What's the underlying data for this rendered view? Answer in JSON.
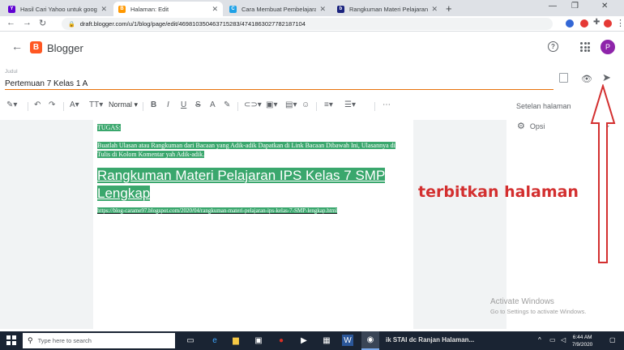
{
  "browser": {
    "tabs": [
      {
        "label": "Hasil Cari Yahoo untuk google",
        "fav_color": "#6001d2",
        "fav_text": "Y"
      },
      {
        "label": "Halaman: Edit",
        "fav_color": "#ff9800",
        "fav_text": "B"
      },
      {
        "label": "Cara Membuat Pembelajaran On",
        "fav_color": "#1ea1e6",
        "fav_text": "C"
      },
      {
        "label": "Rangkuman Materi Pelajaran IPS",
        "fav_color": "#1a237e",
        "fav_text": "bl"
      }
    ],
    "new_tab": "+",
    "url": "draft.blogger.com/u/1/blog/page/edit/4698103504637152​83/4741863027782187104"
  },
  "header": {
    "app_name": "Blogger",
    "help": "?",
    "avatar_letter": "P"
  },
  "title_field": {
    "label": "Judul",
    "value": "Pertemuan 7 Kelas 1 A"
  },
  "toolbar": {
    "format_label": "Normal"
  },
  "content": {
    "line1": "TUGAS:",
    "line2": "Buatlah Ulasan atau Rangkuman dari Bacaan yang Adik-adik Dapatkan di Link Bacaan Dibawah Ini, Ulasannya di Tulis di Kolom Komentar yah Adik-adik.",
    "heading": "Rangkuman Materi Pelajaran IPS Kelas 7 SMP Lengkap",
    "link": "https://blog-carame97.blogspot.com/2020/04/rangkuman-materi-pelajaran-ips-kelas-7-SMP-lengkap.html"
  },
  "sidebar": {
    "title": "Setelan halaman",
    "opsi": "Opsi"
  },
  "annotation": {
    "text": "terbitkan halaman",
    "color": "#d32f2f"
  },
  "watermark": {
    "line1": "Activate Windows",
    "line2": "Go to Settings to activate Windows."
  },
  "taskbar": {
    "search_placeholder": "Type here to search",
    "preview_text": "ik STAI dc Ranjan Halaman...",
    "time": "6:44 AM",
    "date": "7/9/2020"
  }
}
